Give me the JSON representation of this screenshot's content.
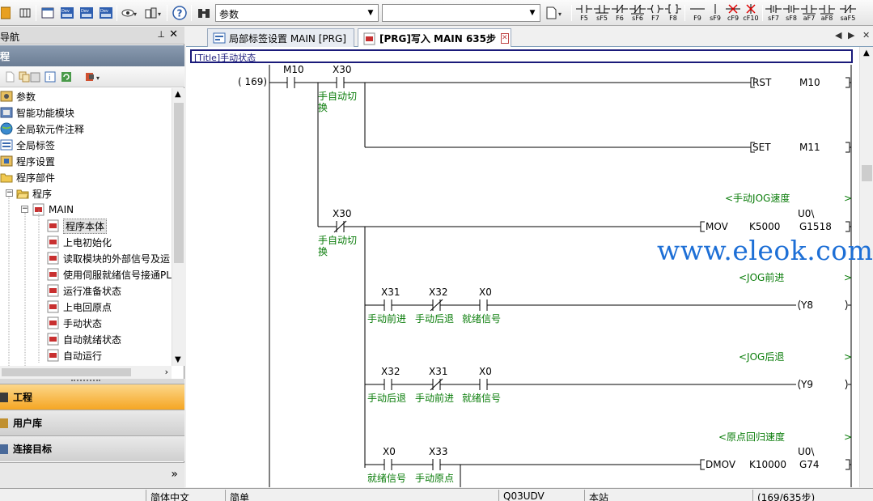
{
  "toolbar": {
    "combo_value": "参数",
    "function_keys": [
      "F5",
      "sF5",
      "F6",
      "sF6",
      "F7",
      "F8",
      "F9",
      "sF9",
      "cF9",
      "cF10",
      "sF7",
      "sF8",
      "aF7",
      "aF8",
      "saF5"
    ]
  },
  "navigation": {
    "title": "导航",
    "pin_glyph": "⊥",
    "close_glyph": "✕",
    "section": "程",
    "tree": [
      {
        "label": "参数"
      },
      {
        "label": "智能功能模块"
      },
      {
        "label": "全局软元件注释"
      },
      {
        "label": "全局标签"
      },
      {
        "label": "程序设置"
      },
      {
        "label": "程序部件"
      },
      {
        "label": "程序"
      },
      {
        "label": "MAIN"
      },
      {
        "label": "程序本体"
      },
      {
        "label": "上电初始化"
      },
      {
        "label": "读取模块的外部信号及运"
      },
      {
        "label": "使用伺服就绪信号接通PL"
      },
      {
        "label": "运行准备状态"
      },
      {
        "label": "上电回原点"
      },
      {
        "label": "手动状态"
      },
      {
        "label": "自动就绪状态"
      },
      {
        "label": "自动运行"
      }
    ],
    "buttons": {
      "project": "工程",
      "library": "用户库",
      "connection": "连接目标"
    },
    "footer_glyph": "»"
  },
  "tabs": [
    {
      "label": "局部标签设置 MAIN [PRG]"
    },
    {
      "label": "[PRG]写入 MAIN 635步"
    }
  ],
  "ladder": {
    "title": "[Title]手动状态",
    "step": "( 169)",
    "contacts": {
      "m10": "M10",
      "x30a": "X30",
      "x30b": "X30",
      "r2x31": "X31",
      "r2x32": "X32",
      "r2x0": "X0",
      "r3x32": "X32",
      "r3x31": "X31",
      "r3x0": "X0",
      "r4x0": "X0",
      "r4x33": "X33"
    },
    "comments": {
      "switch1a": "手自动切",
      "switch1b": "换",
      "switch2a": "手自动切",
      "switch2b": "换",
      "fwd": "手动前进",
      "back": "手动后退",
      "ready": "就绪信号",
      "back2": "手动后退",
      "fwd2": "手动前进",
      "ready2": "就绪信号",
      "ready3": "就绪信号",
      "origin": "手动原点"
    },
    "statements": {
      "jog_speed": "<手动JOG速度",
      "jog_fwd": "<JOG前进",
      "jog_back": "<JOG后退",
      "home_speed": "<原点回归速度",
      "gt": ">"
    },
    "instructions": {
      "rst": "RST",
      "rst_op": "M10",
      "set": "SET",
      "set_op": "M11",
      "mov": "MOV",
      "mov_src": "K5000",
      "mov_dst": "G1518",
      "mov_unit": "U0\\",
      "y8": "Y8",
      "y9": "Y9",
      "dmov": "DMOV",
      "dmov_src": "K10000",
      "dmov_dst": "G74",
      "dmov_unit": "U0\\"
    }
  },
  "watermark": "www.eleok.com",
  "statusbar": {
    "language": "简体中文",
    "mode": "简单",
    "cpu": "Q03UDV",
    "station": "本站",
    "steps": "(169/635步)"
  },
  "colors": {
    "comment_green": "#0b7d0b",
    "active_nav": "#f5a623",
    "watermark_blue": "#1d6fd6"
  }
}
